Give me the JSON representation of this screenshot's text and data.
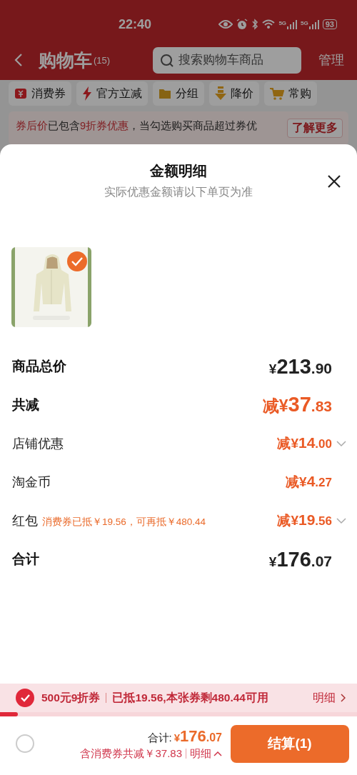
{
  "status_bar": {
    "time": "22:40",
    "networks": [
      "5G",
      "5G"
    ],
    "battery": "93"
  },
  "header": {
    "title": "购物车",
    "count": "(15)",
    "search": {
      "placeholder": "搜索购物车商品"
    },
    "manage": "管理"
  },
  "filters": [
    {
      "label": "消费券"
    },
    {
      "label": "官方立减"
    },
    {
      "label": "分组"
    },
    {
      "label": "降价"
    },
    {
      "label": "常购"
    }
  ],
  "notice": {
    "text": "**券后价**已包含**9折券优惠**，当勾选购买商品超过券优",
    "button": "了解更多"
  },
  "sheet": {
    "title": "金额明细",
    "subtitle": "实际优惠金额请以下单页为准",
    "products": [
      {
        "kind": "picture",
        "selected": true
      }
    ],
    "rows": [
      {
        "kind": "total",
        "label": "商品总价",
        "amount": "¥213.90",
        "expandable": false
      },
      {
        "kind": "reduction",
        "label": "共减",
        "amount": "减¥37.83",
        "expandable": false
      },
      {
        "kind": "item",
        "label": "店铺优惠",
        "amount": "减¥14.00",
        "expandable": true
      },
      {
        "kind": "item",
        "label": "淘金币",
        "amount": "减¥4.27",
        "expandable": false
      },
      {
        "kind": "item",
        "label": "红包",
        "note": "消费券已抵￥19.56，可再抵￥480.44",
        "amount": "减¥19.56",
        "expandable": true
      },
      {
        "kind": "total",
        "label": "合计",
        "amount": "¥176.07",
        "expandable": false
      }
    ]
  },
  "coupon_bar": {
    "checked": true,
    "title": "500元9折券",
    "detail": "已抵19.56,本张券剩480.44可用",
    "link": "明细",
    "level": 0.05
  },
  "footer": {
    "select_all": {
      "checked": false
    },
    "total_label": "合计:",
    "total": "¥176.07",
    "saving": "含消费券共减￥37.83",
    "detail_link": "明细",
    "checkout": "结算(1)"
  }
}
